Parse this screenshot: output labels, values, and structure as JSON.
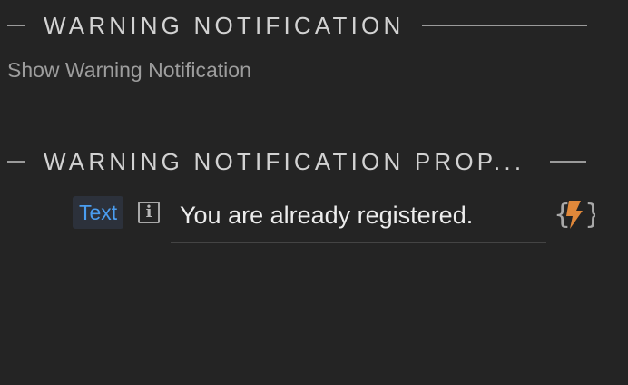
{
  "section1": {
    "title": "WARNING NOTIFICATION",
    "subtitle": "Show Warning Notification"
  },
  "section2": {
    "title": "WARNING NOTIFICATION PROP...",
    "properties": [
      {
        "label": "Text",
        "info_icon": "info-icon",
        "value": "You are already registered.",
        "dynamic_icon": "dynamic-value-bolt-icon"
      }
    ]
  },
  "colors": {
    "background": "#242424",
    "label_accent": "#4a9df0",
    "bolt_accent": "#e0883a"
  }
}
